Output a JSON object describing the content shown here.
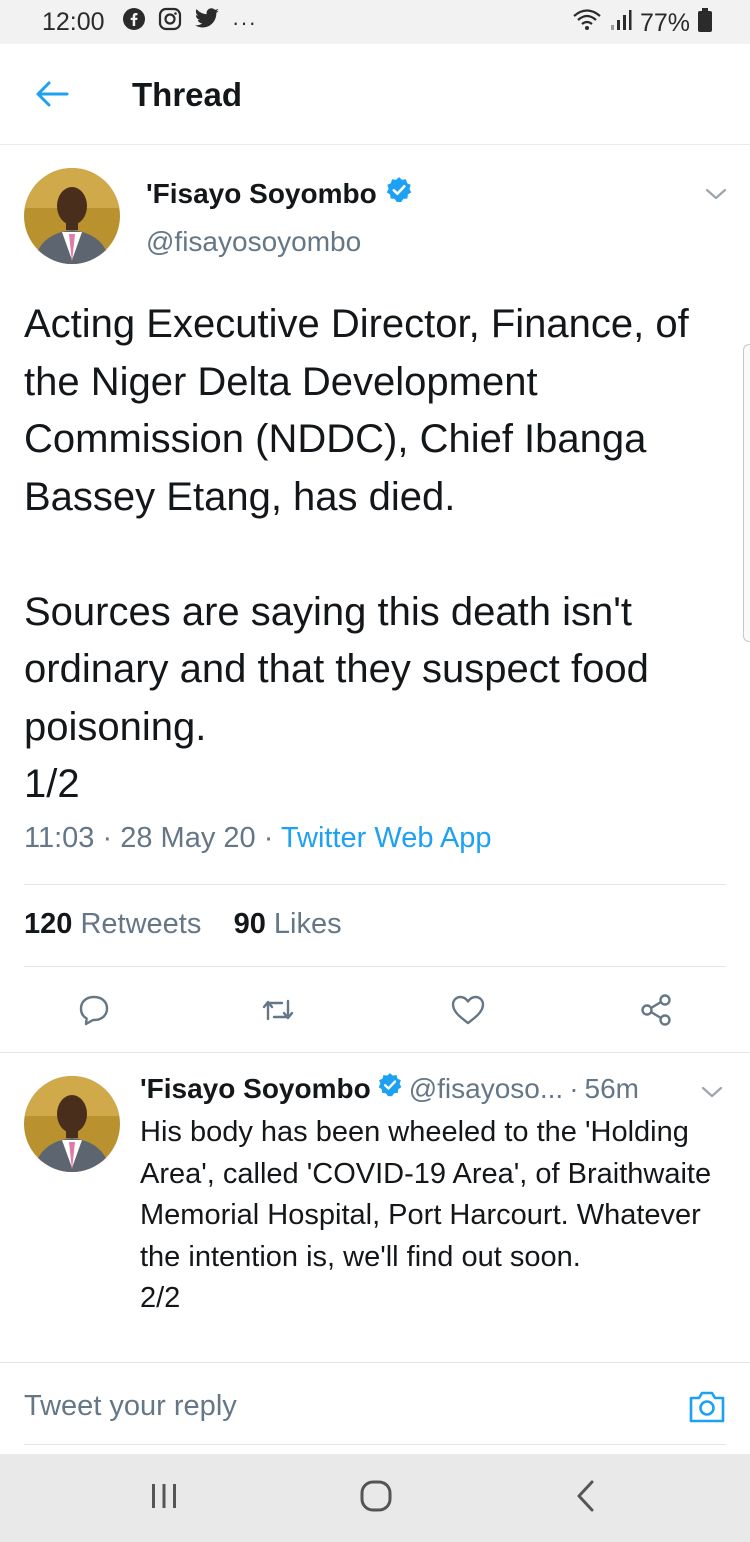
{
  "status_bar": {
    "time": "12:00",
    "app_icons": [
      "facebook-icon",
      "instagram-icon",
      "twitter-icon",
      "more-dots-icon"
    ],
    "more": "···",
    "battery": "77%"
  },
  "header": {
    "title": "Thread"
  },
  "main_tweet": {
    "author_name": "'Fisayo Soyombo",
    "author_handle": "@fisayosoyombo",
    "text": "Acting Executive Director, Finance, of the Niger Delta Development Commission (NDDC), Chief Ibanga Bassey Etang, has died.\n\nSources are saying this death isn't ordinary and that they suspect food poisoning.\n1/2",
    "time": "11:03",
    "date": "28 May 20",
    "separator": "·",
    "source": "Twitter Web App",
    "retweet_count": "120",
    "retweet_label": "Retweets",
    "like_count": "90",
    "like_label": "Likes"
  },
  "reply_tweet": {
    "author_name": "'Fisayo Soyombo",
    "author_handle": "@fisayoso...",
    "separator": "·",
    "age": "56m",
    "text": "His body has been wheeled to the 'Holding Area', called 'COVID-19 Area', of Braithwaite Memorial Hospital, Port Harcourt. Whatever the intention is, we'll find out soon.\n2/2"
  },
  "reply_box": {
    "placeholder": "Tweet your reply"
  },
  "colors": {
    "accent": "#1da1f2",
    "text": "#14171a",
    "muted": "#657786"
  }
}
